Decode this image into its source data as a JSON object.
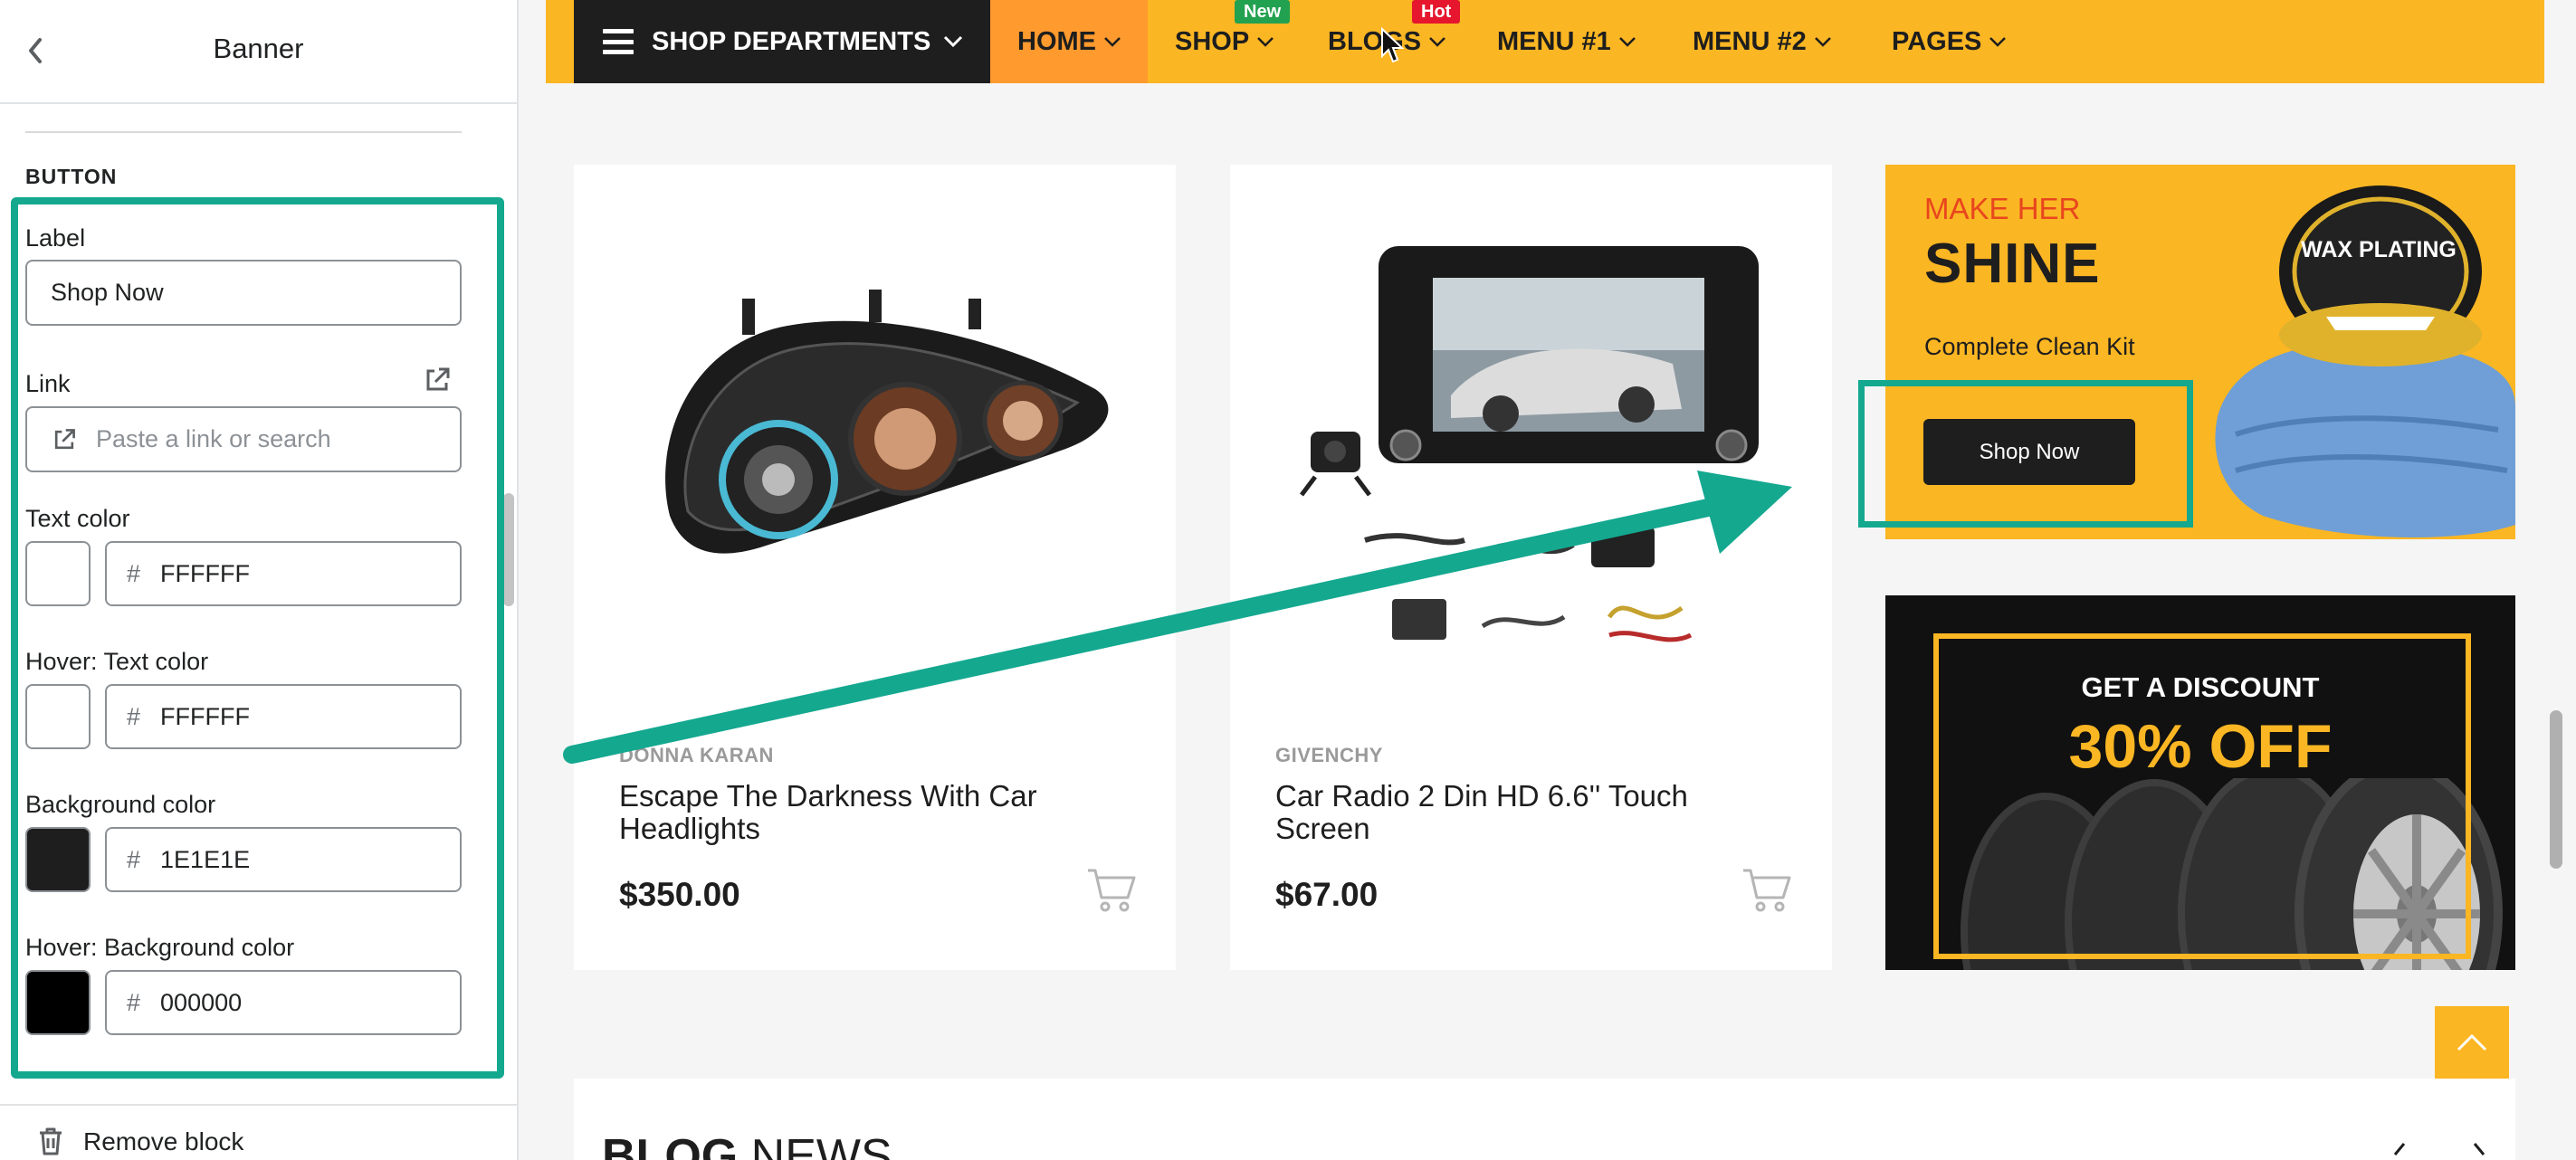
{
  "editor": {
    "title": "Banner",
    "section_title": "BUTTON",
    "fields": {
      "label": {
        "label": "Label",
        "value": "Shop Now"
      },
      "link": {
        "label": "Link",
        "placeholder": "Paste a link or search"
      },
      "text_color": {
        "label": "Text color",
        "hex": "FFFFFF",
        "color": "#ffffff"
      },
      "hover_text_color": {
        "label": "Hover: Text color",
        "hex": "FFFFFF",
        "color": "#ffffff"
      },
      "background_color": {
        "label": "Background color",
        "hex": "1E1E1E",
        "color": "#1e1e1e"
      },
      "hover_background_color": {
        "label": "Hover: Background color",
        "hex": "000000",
        "color": "#000000"
      }
    },
    "remove_block": "Remove block",
    "hash": "#"
  },
  "nav": {
    "departments": "SHOP DEPARTMENTS",
    "items": [
      {
        "label": "HOME"
      },
      {
        "label": "SHOP",
        "badge": "New",
        "badge_color": "#22a150"
      },
      {
        "label": "BLOGS",
        "badge": "Hot",
        "badge_color": "#e5162d"
      },
      {
        "label": "MENU #1"
      },
      {
        "label": "MENU #2"
      },
      {
        "label": "PAGES"
      }
    ]
  },
  "products": [
    {
      "brand": "DONNA KARAN",
      "name": "Escape The Darkness With Car Headlights",
      "price": "$350.00"
    },
    {
      "brand": "GIVENCHY",
      "name": "Car Radio 2 Din HD 6.6'' Touch Screen",
      "price": "$67.00"
    }
  ],
  "banners": {
    "shine": {
      "subtitle": "MAKE HER",
      "title": "SHINE",
      "description": "Complete Clean Kit",
      "button": "Shop Now",
      "product_lid_text": "WAX PLATING"
    },
    "discount": {
      "line1": "GET A DISCOUNT",
      "line2": "30% OFF"
    }
  },
  "blog": {
    "title_bold": "BLOG",
    "title_rest": " NEWS"
  },
  "colors": {
    "accent": "#fbb623",
    "highlight": "#14a88f",
    "nav_active": "#ff9a2e",
    "dark": "#1e1e1e"
  }
}
